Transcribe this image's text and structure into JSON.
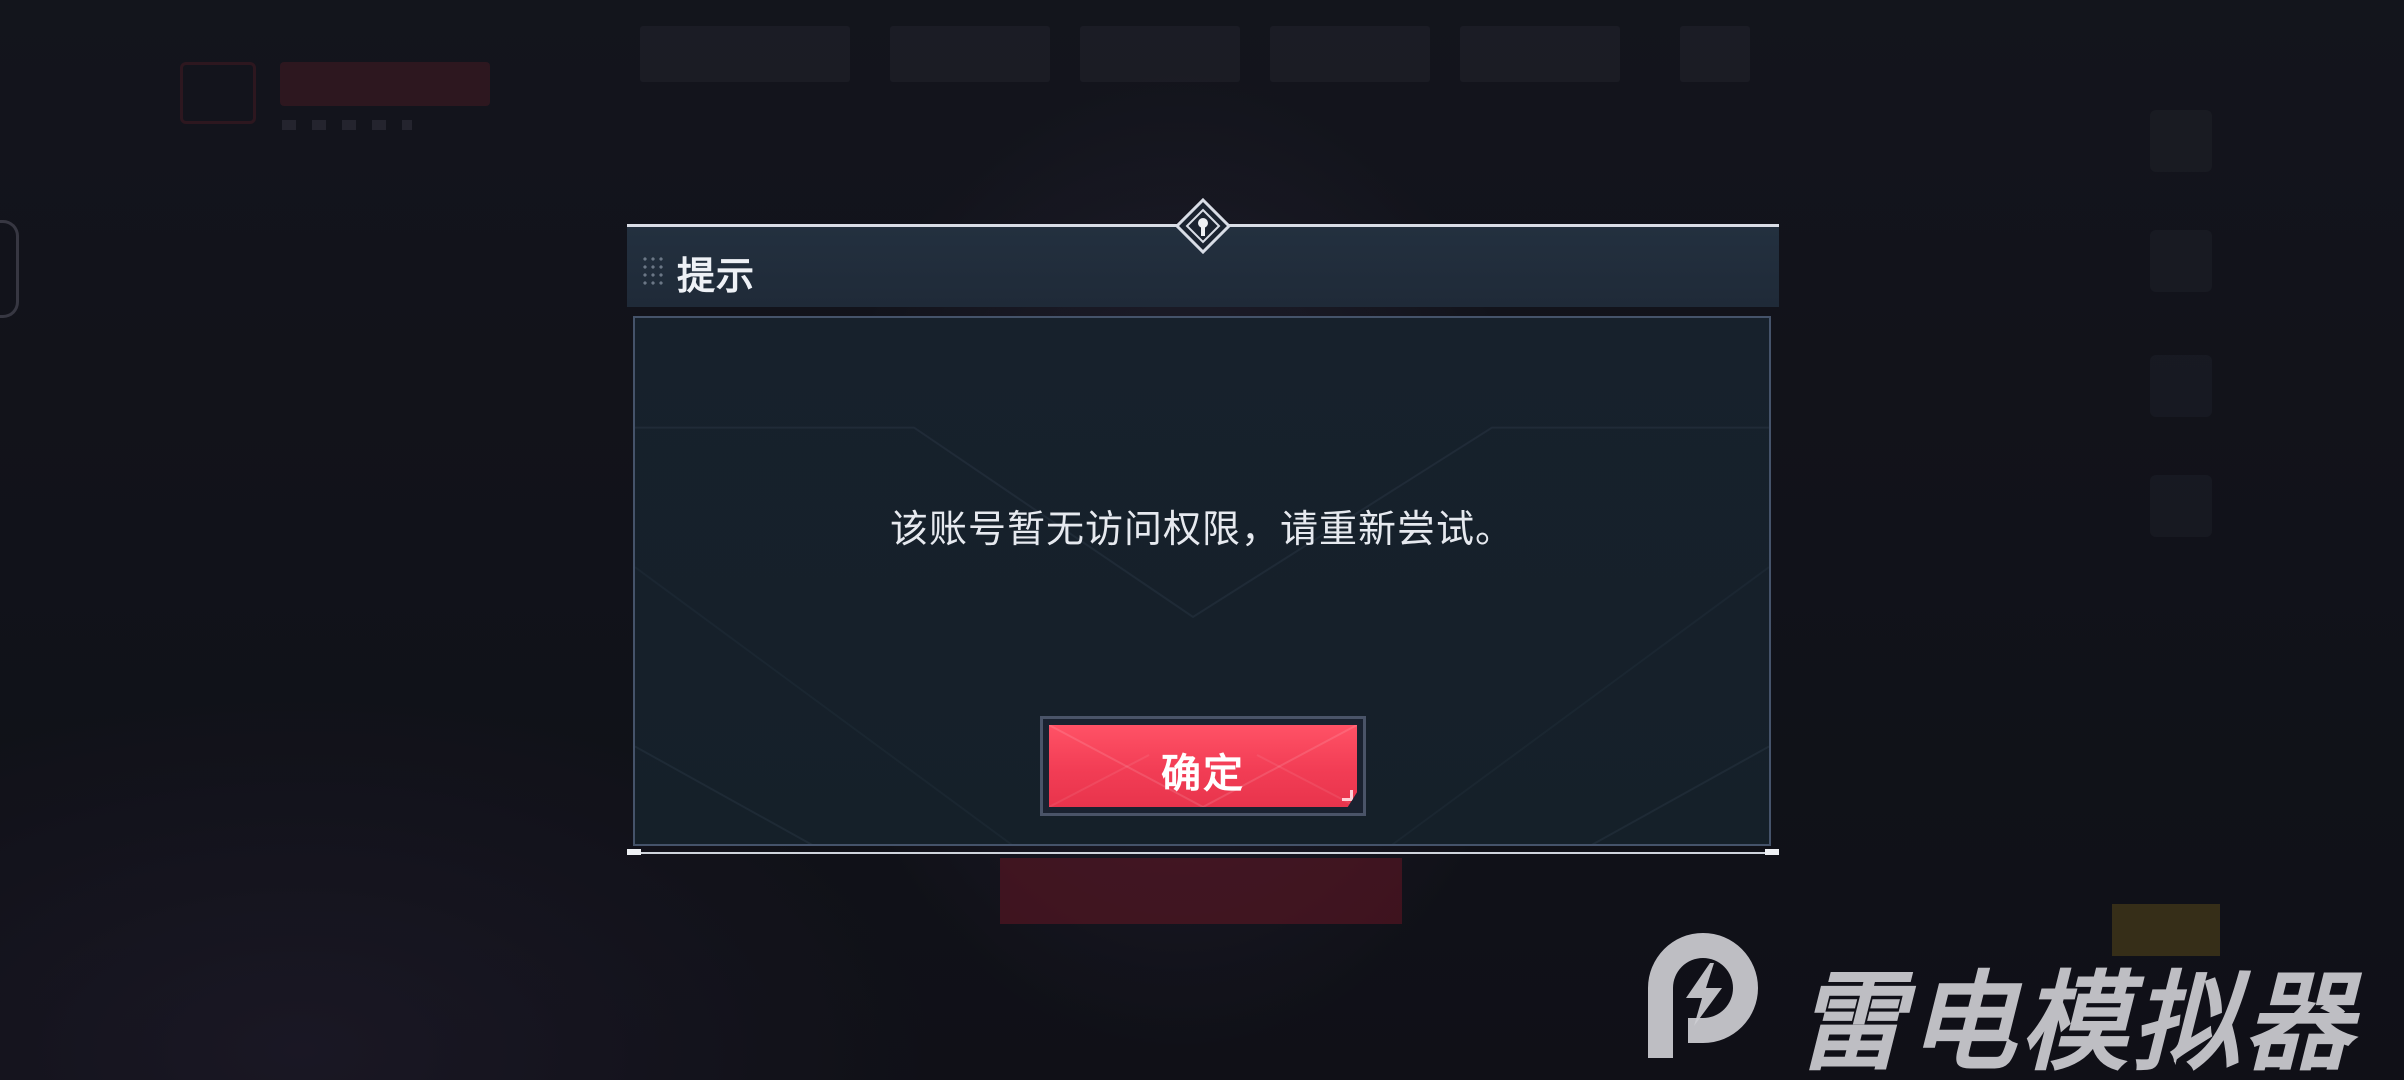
{
  "dialog": {
    "title": "提示",
    "message": "该账号暂无访问权限，请重新尝试。",
    "confirm_label": "确定"
  },
  "watermark": {
    "text": "雷电模拟器",
    "icon": "lightning-bolt-icon"
  },
  "colors": {
    "confirm_button": "#f23d55",
    "dialog_header": "#23303f",
    "dialog_body": "#17212c"
  }
}
